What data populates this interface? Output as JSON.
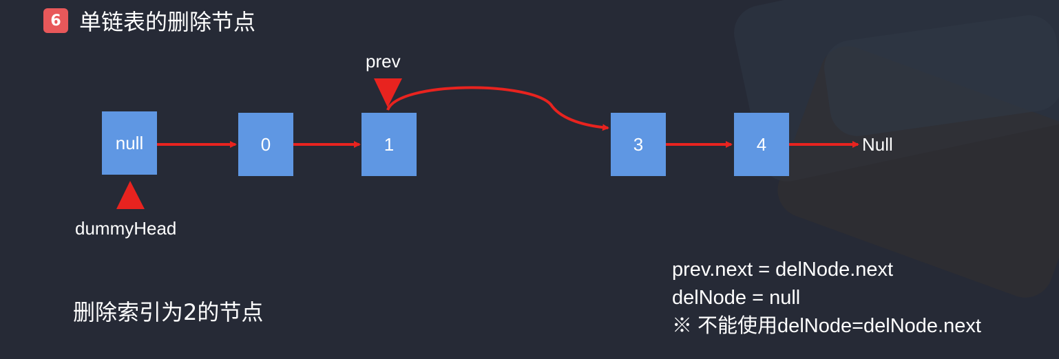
{
  "title": {
    "badge": "6",
    "text": "单链表的删除节点"
  },
  "nodes": [
    "null",
    "0",
    "1",
    "3",
    "4"
  ],
  "end_label": "Null",
  "pointers": {
    "prev": "prev",
    "dummy_head": "dummyHead"
  },
  "caption": "删除索引为2的节点",
  "code_lines": [
    "prev.next = delNode.next",
    "delNode = null",
    "※ 不能使用delNode=delNode.next"
  ],
  "colors": {
    "background": "#262a36",
    "node_fill": "#5f97e3",
    "arrow": "#e8231f",
    "badge": "#e8585a",
    "text": "#ffffff"
  }
}
